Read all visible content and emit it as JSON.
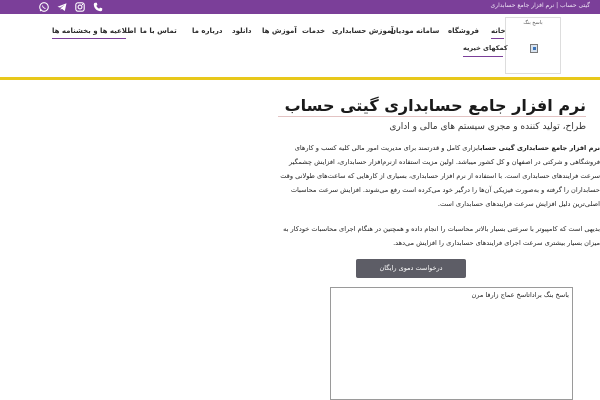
{
  "topbar": {
    "breadcrumb": "گیتی حساب | نرم افزار جامع حسابداری",
    "social_icons": [
      "whatsapp-icon",
      "telegram-icon",
      "instagram-icon",
      "phone-icon"
    ],
    "color": "#7b3f99"
  },
  "logo": {
    "alt_text": "باسخ بنگ"
  },
  "nav": {
    "items": [
      {
        "label": "خانه"
      },
      {
        "label": "فروشگاه"
      },
      {
        "label": "سامانه مودیان"
      },
      {
        "label": "آموزش حسابداری"
      },
      {
        "label": "خدمات"
      },
      {
        "label": "آموزش ها"
      },
      {
        "label": "دانلود"
      },
      {
        "label": "درباره ما"
      },
      {
        "label": "تماس با ما"
      },
      {
        "label": "اطلاعیه ها و بخشنامه ها"
      }
    ],
    "sub_item": "کمکهای خیریه"
  },
  "content": {
    "title": "نرم افزار جامع حسابداری گیتی حساب",
    "subtitle": "طراح، تولید کننده و مجری سیستم های مالی و اداری",
    "para1_bold": "نرم افزار جامع حسابداری گیتی حساب",
    "para1_rest": "ابزاری کامل و قدرتمند برای مدیریت امور مالی کلیه کسب و کارهای فروشگاهی و شرکتی در اصفهان و کل کشور میباشد. اولین مزیت استفاده ازنرم‌افزار حسابداری، افزایش چشمگیر سرعت فرایندهای حسابداری است. با استفاده از نرم افزار حسابداری، بسیاری از کارهایی که ساعت‌های طولانی وقت حسابداران را گرفته و به‌صورت فیزیکی آن‌ها را درگیر خود می‌کرده است رفع می‌شوند. افزایش سرعت محاسبات اصلی‌ترین دلیل افزایش سرعت فرایندهای حسابداری است.",
    "para2": "بدیهی است که کامپیوتر با سرعتی بسیار بالاتر محاسبات را انجام داده و همچنین در هنگام اجرای محاسبات خودکار به میزان بسیار بیشتری سرعت اجرای فرایندهای حسابداری را افزایش می‌دهد.",
    "demo_button": "درخواست دموی رایگان",
    "textarea_value": "باسخ بنگ براداتاسخ عماج زارفا مرن"
  },
  "colors": {
    "accent": "#7b3f99",
    "divider": "#e8c81a",
    "button": "#5d5d66"
  }
}
